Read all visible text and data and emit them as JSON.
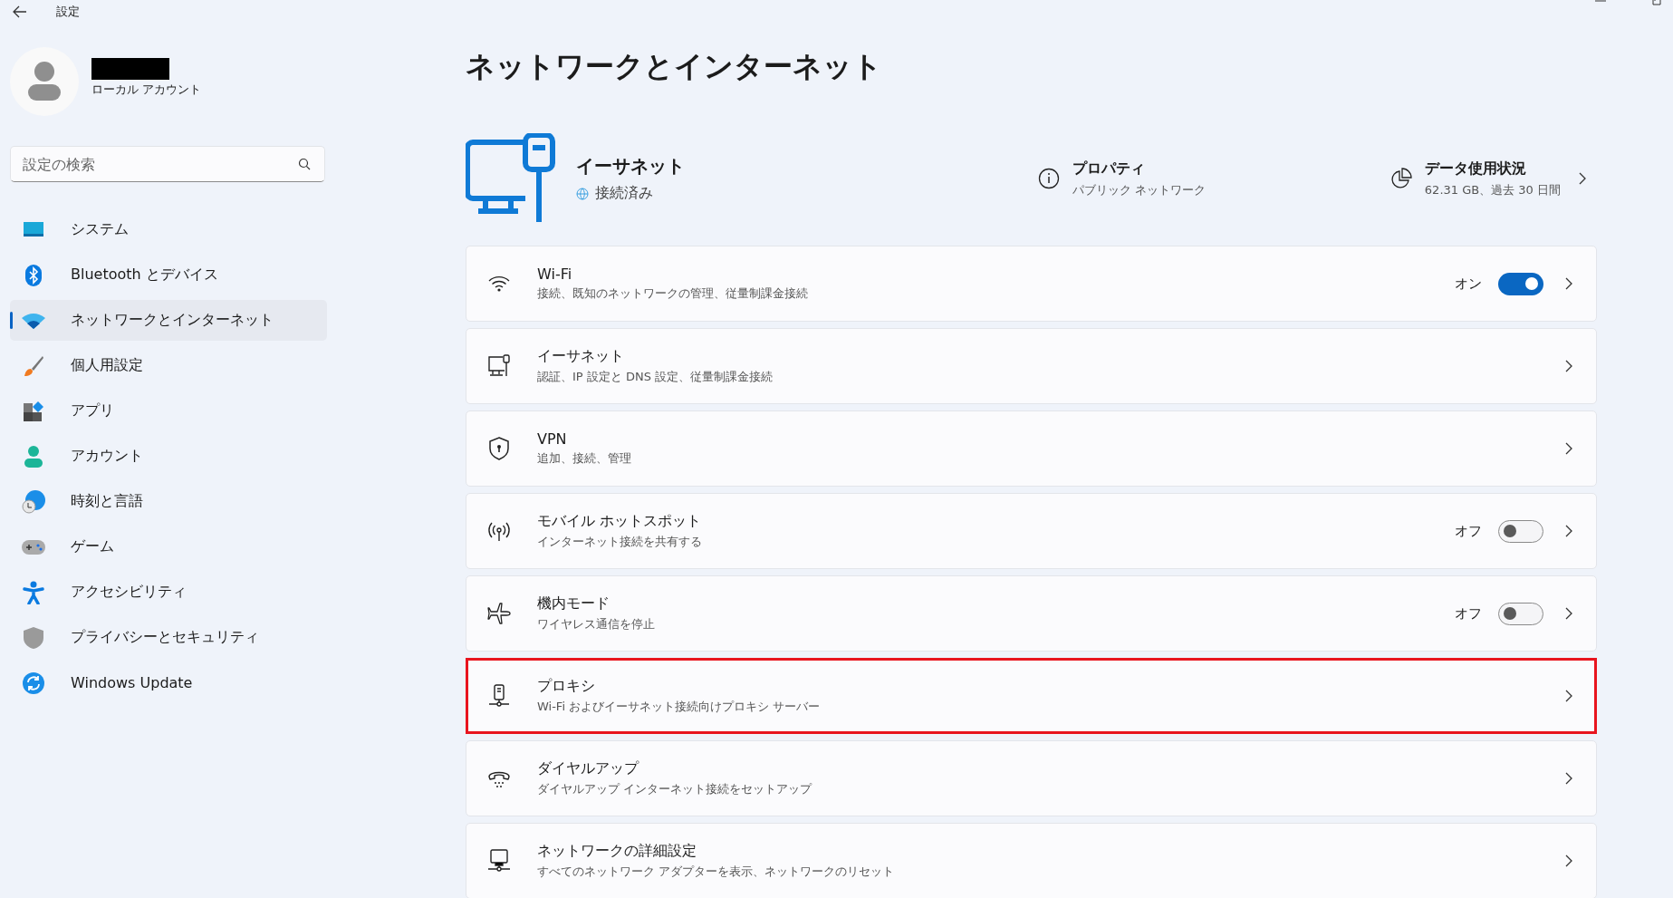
{
  "window": {
    "title": "設定"
  },
  "account": {
    "type": "ローカル アカウント"
  },
  "search": {
    "placeholder": "設定の検索"
  },
  "sidebar": {
    "items": [
      {
        "label": "システム",
        "selected": false
      },
      {
        "label": "Bluetooth とデバイス",
        "selected": false
      },
      {
        "label": "ネットワークとインターネット",
        "selected": true
      },
      {
        "label": "個人用設定",
        "selected": false
      },
      {
        "label": "アプリ",
        "selected": false
      },
      {
        "label": "アカウント",
        "selected": false
      },
      {
        "label": "時刻と言語",
        "selected": false
      },
      {
        "label": "ゲーム",
        "selected": false
      },
      {
        "label": "アクセシビリティ",
        "selected": false
      },
      {
        "label": "プライバシーとセキュリティ",
        "selected": false
      },
      {
        "label": "Windows Update",
        "selected": false
      }
    ]
  },
  "page_title": "ネットワークとインターネット",
  "connection": {
    "name": "イーサネット",
    "status": "接続済み"
  },
  "properties": {
    "title": "プロパティ",
    "subtitle": "パブリック ネットワーク"
  },
  "data_usage": {
    "title": "データ使用状況",
    "subtitle": "62.31 GB、過去 30 日間"
  },
  "settings": [
    {
      "kind": "toggle",
      "title": "Wi-Fi",
      "subtitle": "接続、既知のネットワークの管理、従量制課金接続",
      "state_label": "オン",
      "on": true,
      "highlighted": false
    },
    {
      "kind": "link",
      "title": "イーサネット",
      "subtitle": "認証、IP 設定と DNS 設定、従量制課金接続",
      "highlighted": false
    },
    {
      "kind": "link",
      "title": "VPN",
      "subtitle": "追加、接続、管理",
      "highlighted": false
    },
    {
      "kind": "toggle",
      "title": "モバイル ホットスポット",
      "subtitle": "インターネット接続を共有する",
      "state_label": "オフ",
      "on": false,
      "highlighted": false
    },
    {
      "kind": "toggle",
      "title": "機内モード",
      "subtitle": "ワイヤレス通信を停止",
      "state_label": "オフ",
      "on": false,
      "highlighted": false
    },
    {
      "kind": "link",
      "title": "プロキシ",
      "subtitle": "Wi-Fi およびイーサネット接続向けプロキシ サーバー",
      "highlighted": true
    },
    {
      "kind": "link",
      "title": "ダイヤルアップ",
      "subtitle": "ダイヤルアップ インターネット接続をセットアップ",
      "highlighted": false
    },
    {
      "kind": "link",
      "title": "ネットワークの詳細設定",
      "subtitle": "すべてのネットワーク アダプターを表示、ネットワークのリセット",
      "highlighted": false
    }
  ]
}
